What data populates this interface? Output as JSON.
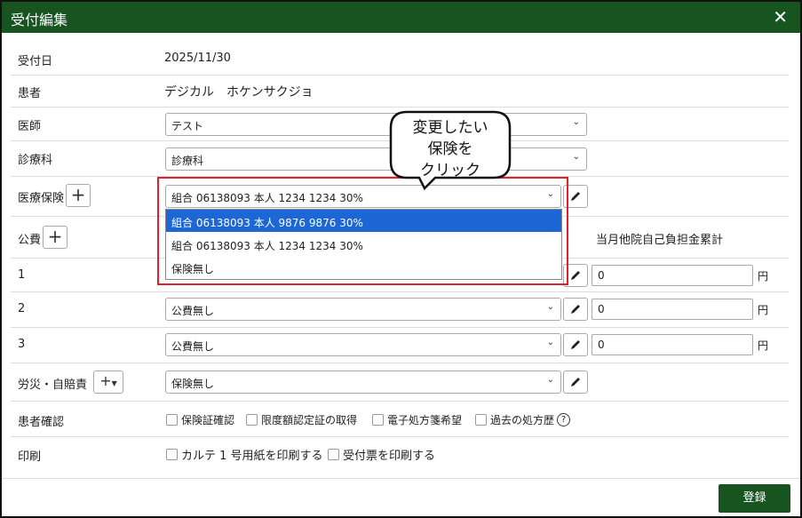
{
  "dialog": {
    "title": "受付編集",
    "submit": "登録"
  },
  "fields": {
    "reception_date": {
      "label": "受付日",
      "value": "2025/11/30"
    },
    "patient": {
      "label": "患者",
      "value": "デジカル　ホケンサクジョ"
    },
    "doctor": {
      "label": "医師",
      "value": "テスト"
    },
    "department": {
      "label": "診療科",
      "value": "診療科"
    },
    "insurance": {
      "label": "医療保険",
      "value": "組合 06138093 本人 1234 1234 30%"
    },
    "public": {
      "label": "公費",
      "cumulative_label": "当月他院自己負担金累計"
    },
    "public_rows": [
      {
        "label": "1",
        "value": "",
        "amount": "0",
        "unit": "円"
      },
      {
        "label": "2",
        "value": "公費無し",
        "amount": "0",
        "unit": "円"
      },
      {
        "label": "3",
        "value": "公費無し",
        "amount": "0",
        "unit": "円"
      }
    ],
    "workers": {
      "label": "労災・自賠責",
      "value": "保険無し"
    },
    "confirm": {
      "label": "患者確認",
      "options": [
        "保険証確認",
        "限度額認定証の取得",
        "電子処方箋希望",
        "過去の処方歴"
      ]
    },
    "print": {
      "label": "印刷",
      "options": [
        "カルテ 1 号用紙を印刷する",
        "受付票を印刷する"
      ]
    }
  },
  "dropdown": {
    "options": [
      "組合 06138093 本人 9876 9876 30%",
      "組合 06138093 本人 1234 1234 30%",
      "保険無し"
    ],
    "highlighted_index": 0
  },
  "annotation": {
    "line1": "変更したい",
    "line2": "保険を",
    "line3": "クリック",
    "color": "#e0202e"
  },
  "colors": {
    "header": "#17541f",
    "highlight": "#1c66d6"
  }
}
